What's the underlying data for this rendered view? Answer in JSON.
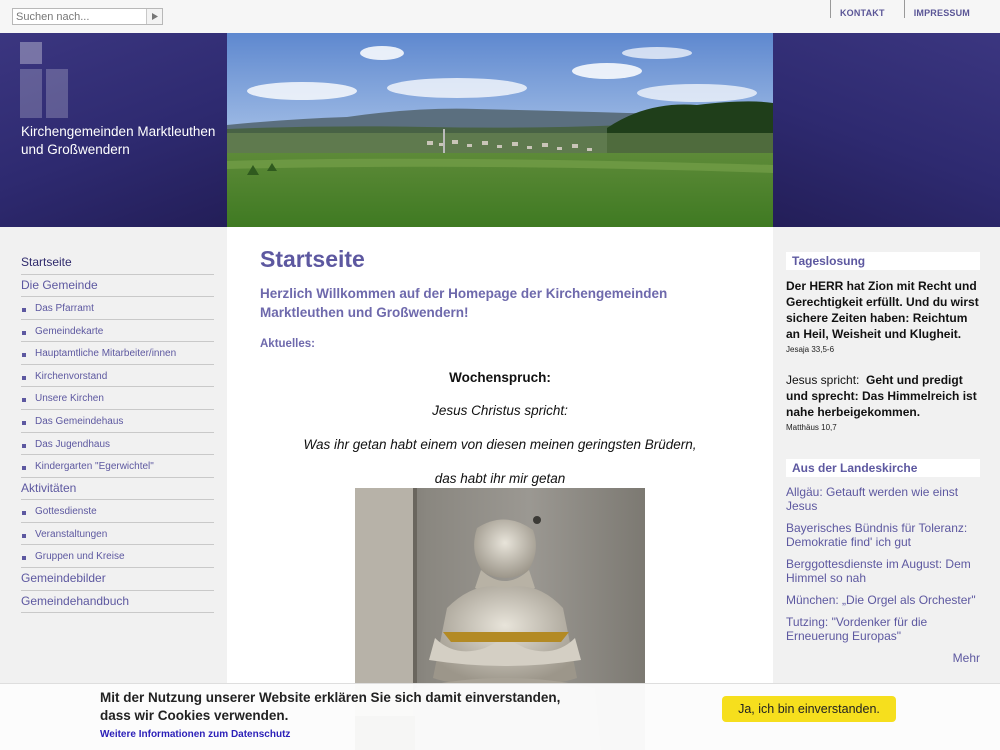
{
  "search": {
    "placeholder": "Suchen nach..."
  },
  "top_links": [
    {
      "label": "KONTAKT"
    },
    {
      "label": "IMPRESSUM"
    }
  ],
  "site": {
    "name": "Kirchengemeinden Marktleuthen und Großwendern"
  },
  "nav": {
    "startseite": "Startseite",
    "gemeinde": "Die Gemeinde",
    "gemeinde_items": [
      "Das Pfarramt",
      "Gemeindekarte",
      "Hauptamtliche Mitarbeiter/innen",
      "Kirchenvorstand",
      "Unsere Kirchen",
      "Das Gemeindehaus",
      "Das Jugendhaus",
      "Kindergarten \"Egerwichtel\""
    ],
    "aktivitaeten": "Aktivitäten",
    "aktivitaeten_items": [
      "Gottesdienste",
      "Veranstaltungen",
      "Gruppen und Kreise"
    ],
    "gemeindebilder": "Gemeindebilder",
    "gemeindehandbuch": "Gemeindehandbuch"
  },
  "main": {
    "title": "Startseite",
    "welcome": "Herzlich Willkommen auf der Homepage der Kirchengemeinden Marktleuthen und Großwendern!",
    "news_label": "Aktuelles:",
    "wochenspruch_title": "Wochenspruch:",
    "line1": "Jesus Christus spricht:",
    "line2": "Was ihr getan habt einem von diesen meinen geringsten Brüdern,",
    "line3": "das habt ihr mir getan"
  },
  "sidebar": {
    "tageslosung_head": "Tageslosung",
    "losung_text": "Der HERR hat Zion mit Recht und Gerechtigkeit erfüllt. Und du wirst sichere Zeiten haben: Reichtum an Heil, Weisheit und Klugheit.",
    "losung_ref": "Jesaja 33,5-6",
    "lehrtext_intro": "Jesus spricht:",
    "lehrtext_text": "Geht und predigt und sprecht: Das Himmelreich ist nahe herbeigekommen.",
    "lehrtext_ref": "Matthäus 10,7",
    "landeskirche_head": "Aus der Landeskirche",
    "news": [
      "Allgäu: Getauft werden wie einst Jesus",
      "Bayerisches Bündnis für Toleranz: Demokratie find' ich gut",
      "Berggottesdienste im August: Dem Himmel so nah",
      "München: „Die Orgel als Orchester\"",
      "Tutzing: \"Vordenker für die Erneuerung Europas\""
    ],
    "more": "Mehr"
  },
  "cookie": {
    "message": "Mit der Nutzung unserer Website erklären Sie sich damit einverstanden, dass wir Cookies verwenden.",
    "link": "Weitere Informationen zum Datenschutz",
    "button": "Ja, ich bin einverstanden."
  },
  "colors": {
    "brand_purple": "#2e2a70",
    "link_purple": "#5d58a0",
    "cookie_button": "#f6df1d"
  }
}
